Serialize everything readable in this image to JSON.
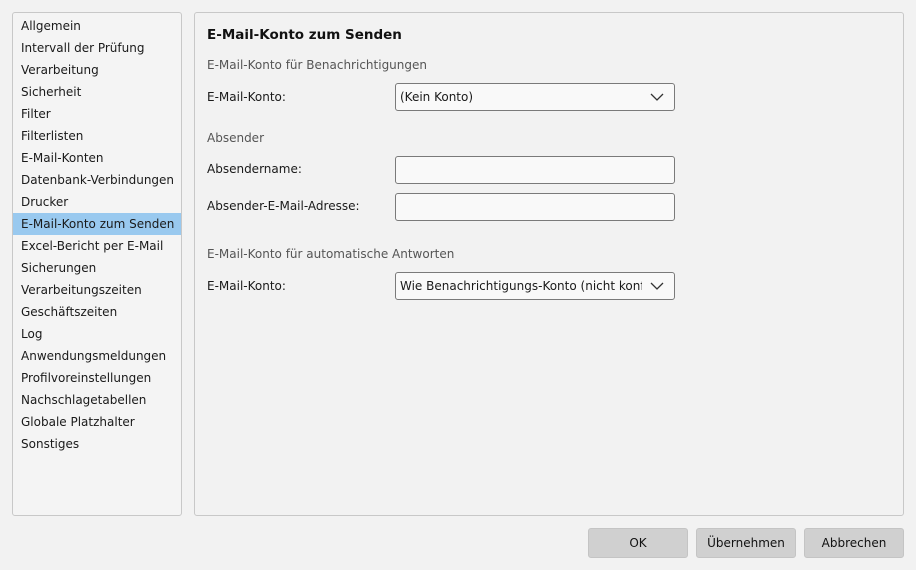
{
  "sidebar": {
    "items": [
      {
        "label": "Allgemein"
      },
      {
        "label": "Intervall der Prüfung"
      },
      {
        "label": "Verarbeitung"
      },
      {
        "label": "Sicherheit"
      },
      {
        "label": "Filter"
      },
      {
        "label": "Filterlisten"
      },
      {
        "label": "E-Mail-Konten"
      },
      {
        "label": "Datenbank-Verbindungen"
      },
      {
        "label": "Drucker"
      },
      {
        "label": "E-Mail-Konto zum Senden"
      },
      {
        "label": "Excel-Bericht per E-Mail"
      },
      {
        "label": "Sicherungen"
      },
      {
        "label": "Verarbeitungszeiten"
      },
      {
        "label": "Geschäftszeiten"
      },
      {
        "label": "Log"
      },
      {
        "label": "Anwendungsmeldungen"
      },
      {
        "label": "Profilvoreinstellungen"
      },
      {
        "label": "Nachschlagetabellen"
      },
      {
        "label": "Globale Platzhalter"
      },
      {
        "label": "Sonstiges"
      }
    ],
    "selected": "E-Mail-Konto zum Senden"
  },
  "main": {
    "title": "E-Mail-Konto zum Senden",
    "notifications": {
      "heading": "E-Mail-Konto für Benachrichtigungen",
      "account_label": "E-Mail-Konto:",
      "account_value": "(Kein Konto)"
    },
    "sender": {
      "heading": "Absender",
      "name_label": "Absendername:",
      "name_value": "",
      "email_label": "Absender-E-Mail-Adresse:",
      "email_value": ""
    },
    "auto_reply": {
      "heading": "E-Mail-Konto für automatische Antworten",
      "account_label": "E-Mail-Konto:",
      "account_value": "Wie Benachrichtigungs-Konto (nicht konfiguri"
    }
  },
  "footer": {
    "ok_label": "OK",
    "apply_label": "Übernehmen",
    "cancel_label": "Abbrechen"
  },
  "colors": {
    "selection": "#99c9ef",
    "button": "#d0d0d0",
    "background": "#f2f2f2"
  }
}
